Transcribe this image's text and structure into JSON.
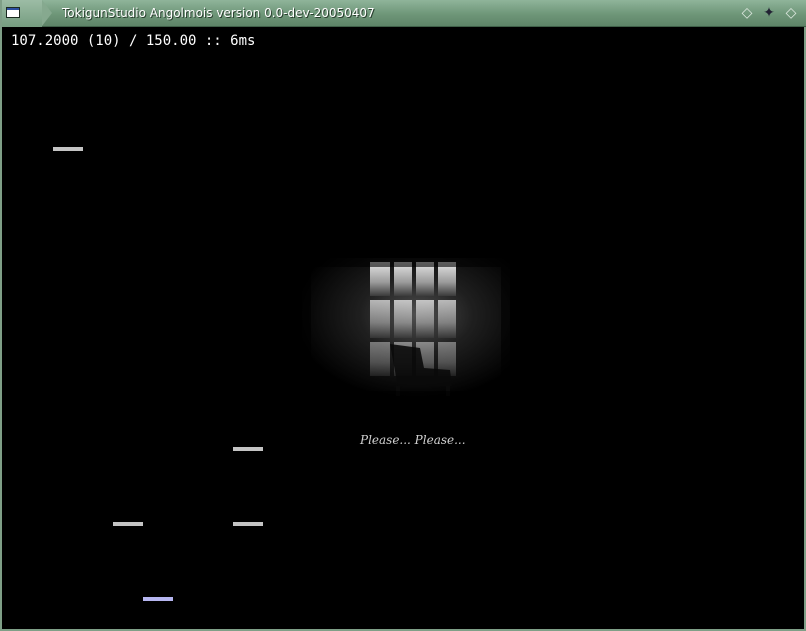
{
  "window": {
    "title": "TokigunStudio Angolmois version 0.0-dev-20050407",
    "icon": "app-window-icon",
    "controls": [
      "minimize-icon",
      "maximize-icon",
      "close-icon"
    ],
    "controls_glyphs": [
      "◇",
      "✦",
      "◇"
    ]
  },
  "hud": {
    "stats_text": "107.2000 (10) / 150.00 :: 6ms"
  },
  "bga": {
    "description_icon": "window-silhouette-image",
    "caption": "Please... Please..."
  },
  "colors": {
    "titlebar": "#6e9678",
    "background": "#000000",
    "note": "#c4c4c4",
    "note_highlight": "#b6b6f0"
  }
}
